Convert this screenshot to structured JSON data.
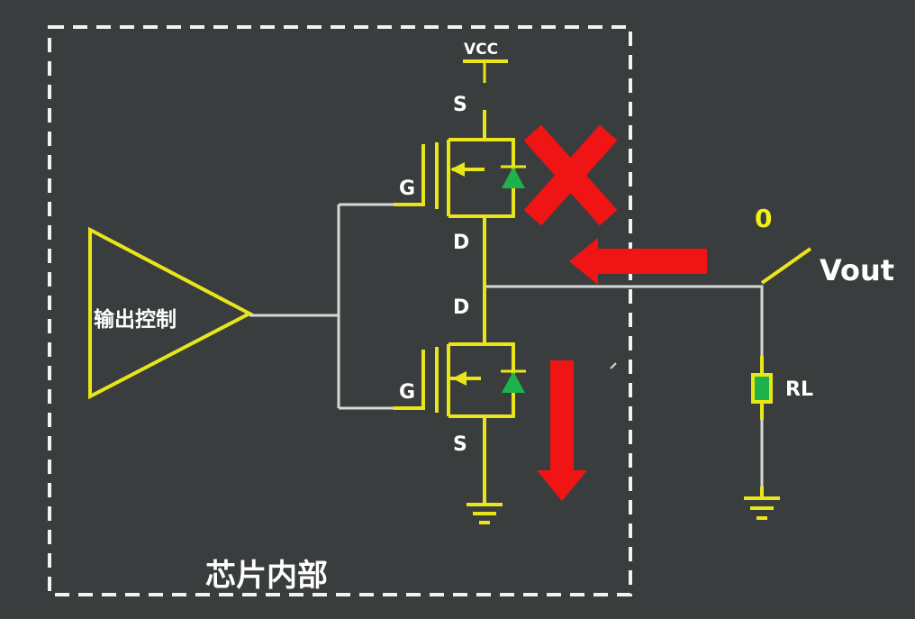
{
  "labels": {
    "vcc": "VCC",
    "source_top": "S",
    "drain_top": "D",
    "gate_top": "G",
    "drain_bottom": "D",
    "gate_bottom": "G",
    "source_bottom": "S",
    "output_control": "输出控制",
    "chip_inside": "芯片内部",
    "vout": "Vout",
    "vout_level": "0",
    "rl": "RL"
  },
  "colors": {
    "background": "#3a3d3e",
    "wire_white": "#d8d8d8",
    "wire_yellow": "#e8e61a",
    "label_white": "#ffffff",
    "label_yellow": "#f2ef1a",
    "diode_green": "#1db34a",
    "arrow_red": "#f01414",
    "dashed_border": "#f2f2f2"
  },
  "icons": {
    "off_mark": "red-x-icon",
    "current_arrow_left": "red-arrow-left-icon",
    "current_arrow_down": "red-arrow-down-icon",
    "ground_mosfet": "ground-icon",
    "ground_load": "ground-icon"
  }
}
